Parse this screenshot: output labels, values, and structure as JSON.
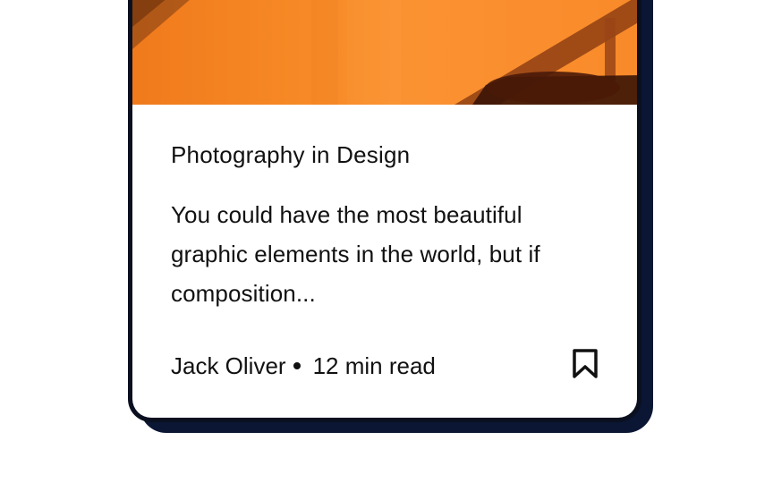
{
  "card": {
    "title": "Photography in Design",
    "excerpt": "You could have the most beautiful graphic elements in the world, but if composition...",
    "author": "Jack Oliver",
    "read_time": "12 min read",
    "bookmark_icon": "bookmark-icon",
    "hero_image": "orange-architecture-photo"
  },
  "colors": {
    "accent": "#f78a26",
    "shadow": "#0a1633",
    "text": "#111111"
  }
}
